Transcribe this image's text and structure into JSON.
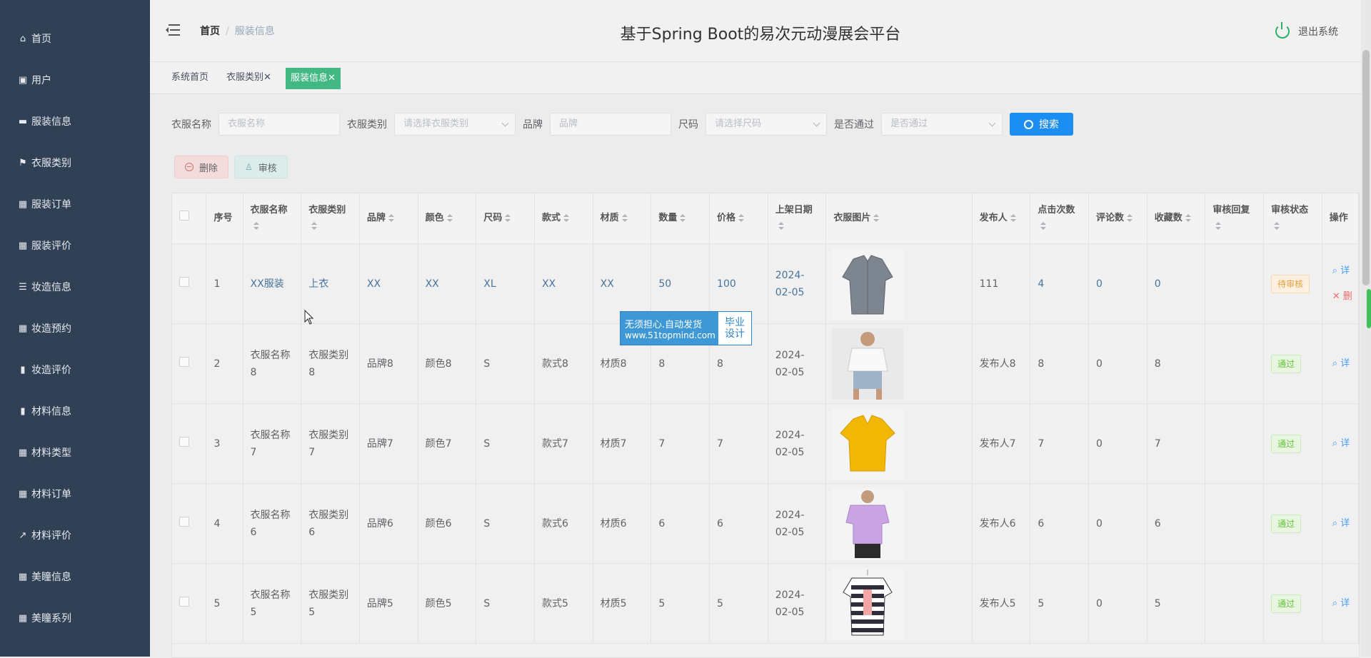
{
  "sidebar": {
    "items": [
      {
        "label": "首页",
        "icon": "home-icon"
      },
      {
        "label": "用户",
        "icon": "user-icon"
      },
      {
        "label": "服装信息",
        "icon": "monitor-icon"
      },
      {
        "label": "衣服类别",
        "icon": "flag-icon"
      },
      {
        "label": "服装订单",
        "icon": "grid-icon"
      },
      {
        "label": "服装评价",
        "icon": "grid-icon"
      },
      {
        "label": "妆造信息",
        "icon": "list-icon"
      },
      {
        "label": "妆造预约",
        "icon": "grid-icon"
      },
      {
        "label": "妆造评价",
        "icon": "bar-chart-icon"
      },
      {
        "label": "材料信息",
        "icon": "bar-chart-icon"
      },
      {
        "label": "材料类型",
        "icon": "grid-icon"
      },
      {
        "label": "材料订单",
        "icon": "grid-icon"
      },
      {
        "label": "材料评价",
        "icon": "line-chart-icon"
      },
      {
        "label": "美瞳信息",
        "icon": "grid-icon"
      },
      {
        "label": "美瞳系列",
        "icon": "grid-icon"
      }
    ]
  },
  "header": {
    "breadcrumb_home": "首页",
    "breadcrumb_sep": "/",
    "breadcrumb_current": "服装信息",
    "title": "基于Spring Boot的易次元动漫展会平台",
    "logout": "退出系统"
  },
  "tags": [
    {
      "label": "系统首页",
      "closable": false,
      "active": false
    },
    {
      "label": "衣服类别",
      "closable": true,
      "active": false
    },
    {
      "label": "服装信息",
      "closable": true,
      "active": true
    }
  ],
  "filters": {
    "name_label": "衣服名称",
    "name_placeholder": "衣服名称",
    "category_label": "衣服类别",
    "category_placeholder": "请选择衣服类别",
    "brand_label": "品牌",
    "brand_placeholder": "品牌",
    "size_label": "尺码",
    "size_placeholder": "请选择尺码",
    "approved_label": "是否通过",
    "approved_placeholder": "是否通过",
    "search_button": "搜索"
  },
  "actions": {
    "delete": "删除",
    "audit": "审核"
  },
  "table": {
    "headers": [
      "序号",
      "衣服名称",
      "衣服类别",
      "品牌",
      "颜色",
      "尺码",
      "款式",
      "材质",
      "数量",
      "价格",
      "上架日期",
      "衣服图片",
      "发布人",
      "点击次数",
      "评论数",
      "收藏数",
      "审核回复",
      "审核状态",
      "操作"
    ],
    "rows": [
      {
        "no": "1",
        "name": "XX服装",
        "category": "上衣",
        "brand": "XX",
        "color": "XX",
        "size": "XL",
        "style": "XX",
        "material": "XX",
        "qty": "50",
        "price": "100",
        "date": "2024-02-05",
        "image": "gray-shirt",
        "publisher": "111",
        "clicks": "4",
        "comments": "0",
        "favs": "0",
        "reply": "",
        "status": "待审核",
        "ops": [
          "详",
          "删"
        ]
      },
      {
        "no": "2",
        "name": "衣服名称8",
        "category": "衣服类别8",
        "brand": "品牌8",
        "color": "颜色8",
        "size": "S",
        "style": "款式8",
        "material": "材质8",
        "qty": "8",
        "price": "8",
        "date": "2024-02-05",
        "image": "white-tee-model",
        "publisher": "发布人8",
        "clicks": "8",
        "comments": "0",
        "favs": "8",
        "reply": "",
        "status": "通过",
        "ops": [
          "详"
        ]
      },
      {
        "no": "3",
        "name": "衣服名称7",
        "category": "衣服类别7",
        "brand": "品牌7",
        "color": "颜色7",
        "size": "S",
        "style": "款式7",
        "material": "材质7",
        "qty": "7",
        "price": "7",
        "date": "2024-02-05",
        "image": "yellow-polo",
        "publisher": "发布人7",
        "clicks": "7",
        "comments": "0",
        "favs": "7",
        "reply": "",
        "status": "通过",
        "ops": [
          "详"
        ]
      },
      {
        "no": "4",
        "name": "衣服名称6",
        "category": "衣服类别6",
        "brand": "品牌6",
        "color": "颜色6",
        "size": "S",
        "style": "款式6",
        "material": "材质6",
        "qty": "6",
        "price": "6",
        "date": "2024-02-05",
        "image": "purple-tee-model",
        "publisher": "发布人6",
        "clicks": "6",
        "comments": "0",
        "favs": "6",
        "reply": "",
        "status": "通过",
        "ops": [
          "详"
        ]
      },
      {
        "no": "5",
        "name": "衣服名称5",
        "category": "衣服类别5",
        "brand": "品牌5",
        "color": "颜色5",
        "size": "S",
        "style": "款式5",
        "material": "材质5",
        "qty": "5",
        "price": "5",
        "date": "2024-02-05",
        "image": "striped-tee",
        "publisher": "发布人5",
        "clicks": "5",
        "comments": "0",
        "favs": "5",
        "reply": "",
        "status": "通过",
        "ops": [
          "详"
        ]
      }
    ]
  },
  "watermark": {
    "line1": "无须担心.自动发货",
    "line2": "www.51topmind.com",
    "right1": "毕业",
    "right2": "设计"
  },
  "colors": {
    "sidebar_bg": "#304156",
    "accent": "#42b983",
    "search_btn": "#1c8ef2",
    "pending": "#e6a23c",
    "pass": "#67c23a"
  }
}
